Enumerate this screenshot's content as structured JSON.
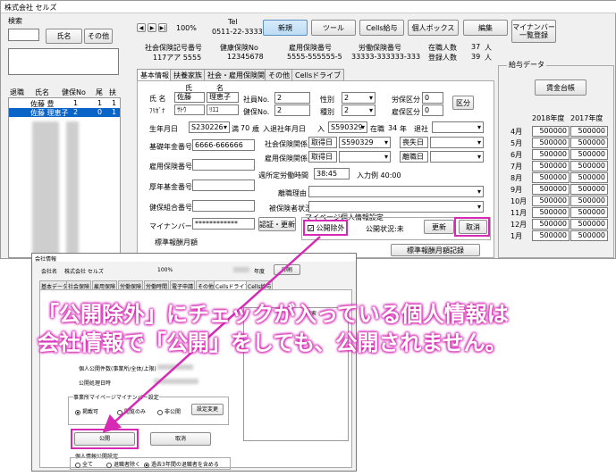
{
  "window": {
    "title": "株式会社 セルズ"
  },
  "left_panel": {
    "search_label": "検索",
    "name_btn": "氏名",
    "other_btn": "その他",
    "headers": [
      "退職",
      "氏名",
      "健保No",
      "尾",
      "扶"
    ],
    "rows": [
      {
        "name": "佐藤 豊",
        "no": "1",
        "o": "1",
        "f": "1"
      },
      {
        "name": "佐藤 理恵子",
        "no": "2",
        "o": "0",
        "f": "1"
      }
    ]
  },
  "toolbar": {
    "zoom": "100%",
    "tel_label": "Tel",
    "tel": "0511-22-3333",
    "buttons": [
      "新規",
      "ツール",
      "Cells給与",
      "個人ボックス",
      "編集"
    ],
    "mynumber_btn": "マイナンバー一覧登録"
  },
  "company_info": {
    "labels": [
      "社会保険記号番号",
      "健康保険No",
      "雇用保険番号",
      "労働保険番号",
      "在職人数",
      "登録人数"
    ],
    "values": [
      "117アア 5555",
      "12345678",
      "5555-555555-5",
      "33333-333333-333",
      "37",
      "39"
    ],
    "unit": "人"
  },
  "tabs": [
    "基本情報",
    "扶養家族",
    "社会・雇用保険関係",
    "その他",
    "Cellsドライブ"
  ],
  "form": {
    "name_label": "氏 名",
    "kana_label": "ﾌﾘｶﾞﾅ",
    "sei_label": "氏",
    "mei_label": "名",
    "sei": "佐藤",
    "mei": "理恵子",
    "sei_kana": "ｻﾄｳ",
    "mei_kana": "ﾘｴｺ",
    "emp_no_label": "社員No.",
    "emp_no": "2",
    "kenpo_label": "健保No.",
    "kenpo_no": "2",
    "sex_label": "性別",
    "sex": "2",
    "type_label": "種別",
    "type": "2",
    "rousai_label": "労保区分",
    "rousai": "0",
    "koyou_label": "雇保区分",
    "koyou": "0",
    "kubun_btn": "区分",
    "birth_label": "生年月日",
    "birth": "S230226",
    "age_prefix": "満",
    "age": "70",
    "age_suffix": "歳",
    "join_label": "入退社年月日",
    "join_prefix": "入",
    "join": "S590329",
    "tenure_label": "在職",
    "tenure": "34",
    "tenure_suffix": "年",
    "leave_label": "退社",
    "pension_label": "基礎年金番号",
    "pension": "6666-666666",
    "shaho_label": "社会保険関係",
    "shutoku_label": "取得日",
    "shutoku": "S590329",
    "soshitsu_label": "喪失日",
    "koyouho_label": "雇用保険番号",
    "koyou_rel_label": "雇用保険関係",
    "shutoku2_label": "取得日",
    "rishoku_label": "離職日",
    "kounen_label": "厚年基金番号",
    "weekly_label": "週所定労働時間",
    "weekly": "38:45",
    "example": "入力例 40:00",
    "kenkou_label": "健保組合番号",
    "rishoku_reason_label": "離職理由",
    "hihokensha_label": "被保険者状況",
    "mynumber_label": "マイナンバー",
    "mynumber": "************",
    "auth_btn": "認証・更新",
    "mypage_label": "マイページ個人情報設定",
    "exclude_label": "公開除外",
    "status_label": "公開状況:未",
    "update_btn": "更新",
    "cancel_btn": "取消",
    "monthly_label": "標準報酬月額",
    "monthly_record_btn": "標準報酬月額記録"
  },
  "salary": {
    "title": "給与データ",
    "ledger_btn": "賃金台帳",
    "years": [
      "2018年度",
      "2017年度"
    ],
    "months": [
      "4月",
      "5月",
      "6月",
      "7月",
      "8月",
      "9月",
      "10月",
      "11月",
      "12月",
      "1月"
    ],
    "values": [
      "500000",
      "500000",
      "500000",
      "500000",
      "500000",
      "500000",
      "500000",
      "500000",
      "500000",
      "500000"
    ]
  },
  "company_window": {
    "title": "会社情報",
    "company_label": "会社名",
    "company": "株式会社 セルズ",
    "zoom": "100%",
    "year_suffix": "年度",
    "print_btn": "印刷",
    "tabs": [
      "基本データ",
      "社会保険",
      "雇用保険",
      "労働保険",
      "労働時間",
      "電子申請",
      "その他",
      "Cellsドライブ",
      "Cells給与"
    ],
    "search_label": "検索",
    "personal_label": "個人公開件数(事業所/全体/上限)",
    "process_date_label": "公開処理日時",
    "mynumber_group": "事業所マイページマイナンバー設定",
    "radio_options": [
      "掲載可",
      "閲覧のみ",
      "非公開"
    ],
    "settings_btn": "設定変更",
    "publish_btn": "公開",
    "cancel_btn": "取消",
    "scope_label": "個人情報公開設定",
    "scope_options": [
      "全て",
      "退職者除く",
      "過去3年間の退職者を含める"
    ]
  },
  "annotation": {
    "line1": "「公開除外」にチェックが入っている個人情報は",
    "line2": "会社情報で「公開」をしても、公開されません。",
    "color": "#d62ab4"
  }
}
